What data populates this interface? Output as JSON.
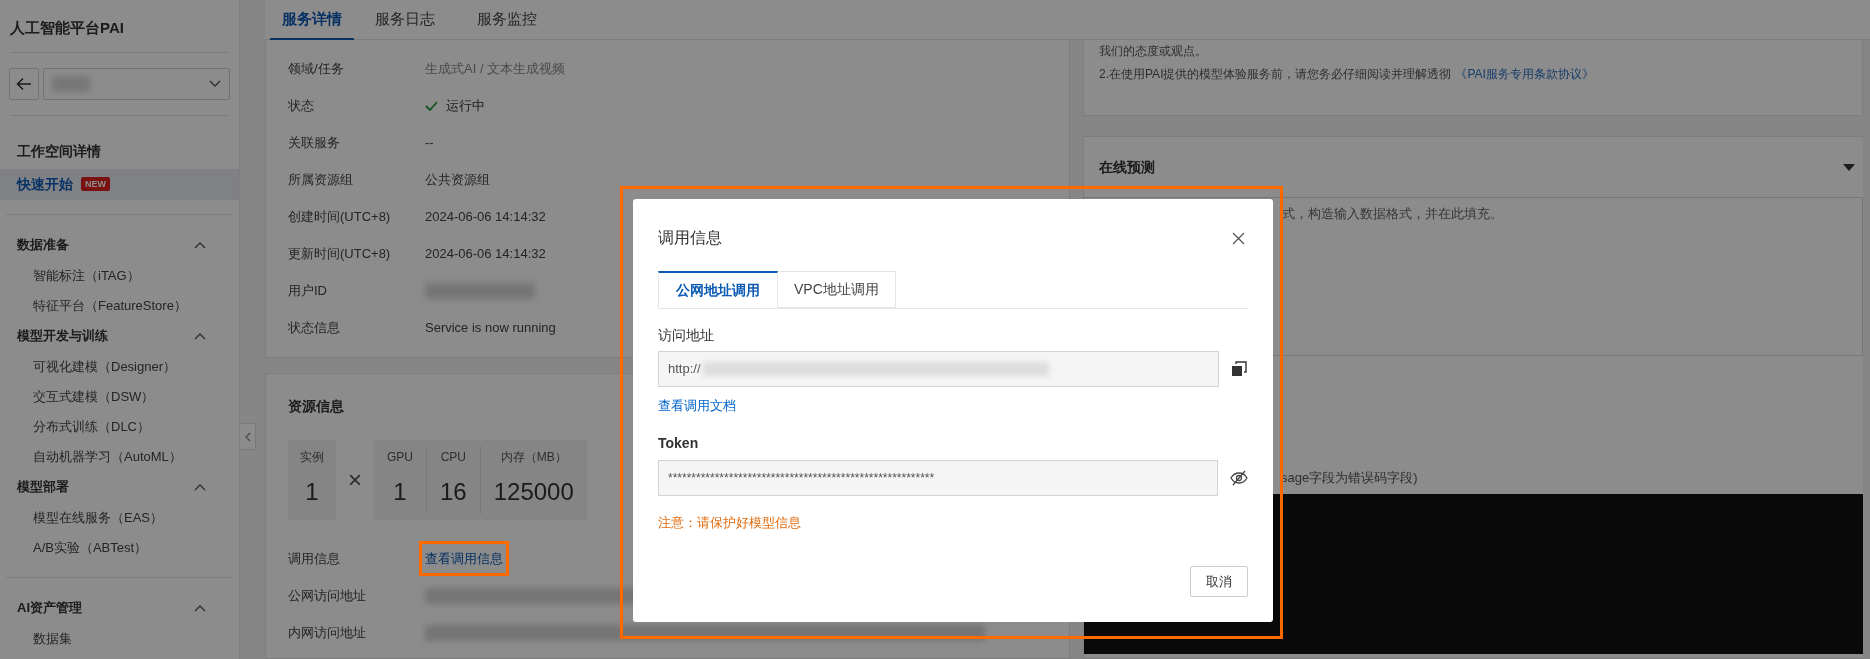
{
  "sidebar": {
    "title": "人工智能平台PAI",
    "nav": [
      {
        "label": "工作空间详情",
        "selected": false
      },
      {
        "label": "快速开始",
        "selected": true,
        "badge": "NEW"
      }
    ],
    "groups": [
      {
        "title": "数据准备",
        "expanded": true,
        "items": [
          "智能标注（iTAG）",
          "特征平台（FeatureStore）"
        ]
      },
      {
        "title": "模型开发与训练",
        "expanded": true,
        "items": [
          "可视化建模（Designer）",
          "交互式建模（DSW）",
          "分布式训练（DLC）",
          "自动机器学习（AutoML）"
        ]
      },
      {
        "title": "模型部署",
        "expanded": true,
        "items": [
          "模型在线服务（EAS）",
          "A/B实验（ABTest）"
        ]
      },
      {
        "title": "AI资产管理",
        "expanded": true,
        "items": [
          "数据集"
        ]
      }
    ]
  },
  "tabs": [
    {
      "label": "服务详情",
      "selected": true
    },
    {
      "label": "服务日志",
      "selected": false
    },
    {
      "label": "服务监控",
      "selected": false
    }
  ],
  "details": [
    {
      "label": "领域/任务",
      "kind": "muted",
      "value": "生成式AI / 文本生成视频"
    },
    {
      "label": "状态",
      "kind": "status",
      "value": "运行中"
    },
    {
      "label": "关联服务",
      "kind": "text",
      "value": "--"
    },
    {
      "label": "所属资源组",
      "kind": "text",
      "value": "公共资源组"
    },
    {
      "label": "创建时间(UTC+8)",
      "kind": "text",
      "value": "2024-06-06 14:14:32"
    },
    {
      "label": "更新时间(UTC+8)",
      "kind": "text",
      "value": "2024-06-06 14:14:32"
    },
    {
      "label": "用户ID",
      "kind": "redacted"
    },
    {
      "label": "状态信息",
      "kind": "text",
      "value": "Service is now running"
    }
  ],
  "resources": {
    "title": "资源信息",
    "instances": {
      "label": "实例",
      "value": "1"
    },
    "times": "×",
    "specs": [
      {
        "label": "GPU",
        "value": "1"
      },
      {
        "label": "CPU",
        "value": "16"
      },
      {
        "label": "内存（MB）",
        "value": "125000"
      }
    ],
    "rows": [
      {
        "label": "调用信息",
        "kind": "link",
        "value": "查看调用信息",
        "highlighted": true
      },
      {
        "label": "公网访问地址",
        "kind": "redacted"
      },
      {
        "label": "内网访问地址",
        "kind": "redacted"
      }
    ]
  },
  "notice": {
    "lines": [
      {
        "text": "我们的态度或观点。"
      },
      {
        "text": "2.在使用PAI提供的模型体验服务前，请您务必仔细阅读并理解透彻",
        "link": "《PAI服务专用条款协议》"
      }
    ]
  },
  "prediction": {
    "title": "在线预测",
    "expanded": true,
    "placeholder": "式，构造输入数据格式，并在此填充。",
    "response_hint": "sage字段为错误码字段)"
  },
  "dialog": {
    "title": "调用信息",
    "highlighted": true,
    "tabs": [
      {
        "label": "公网地址调用",
        "selected": true
      },
      {
        "label": "VPC地址调用",
        "selected": false
      }
    ],
    "address_label": "访问地址",
    "address_value": "http://",
    "doc_link": "查看调用文档",
    "token_label": "Token",
    "token_value": "*********************************************************",
    "warning": "注意：请保护好模型信息",
    "cancel": "取消"
  }
}
